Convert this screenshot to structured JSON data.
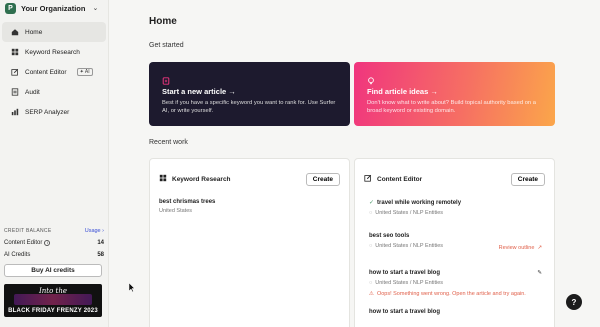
{
  "org": {
    "name": "Your Organization",
    "avatar_letter": "P"
  },
  "nav": [
    {
      "label": "Home",
      "icon": "home-icon"
    },
    {
      "label": "Keyword Research",
      "icon": "grid-icon"
    },
    {
      "label": "Content Editor",
      "icon": "edit-icon",
      "badge": "AI"
    },
    {
      "label": "Audit",
      "icon": "audit-icon"
    },
    {
      "label": "SERP Analyzer",
      "icon": "bar-chart-icon"
    }
  ],
  "credits": {
    "heading": "CREDIT BALANCE",
    "usage_link": "Usage",
    "content_editor_label": "Content Editor",
    "content_editor_value": "14",
    "ai_credits_label": "AI Credits",
    "ai_credits_value": "58",
    "buy_button": "Buy AI credits"
  },
  "promo": {
    "top": "Into the",
    "bottom": "BLACK FRIDAY FRENZY 2023"
  },
  "main": {
    "title": "Home",
    "get_started": "Get started",
    "card_article": {
      "title": "Start a new article →",
      "desc": "Best if you have a specific keyword you want to rank for. Use Surfer AI, or write yourself."
    },
    "card_ideas": {
      "title": "Find article ideas →",
      "desc": "Don't know what to write about? Build topical authority based on a broad keyword or existing domain."
    },
    "recent_work": "Recent work",
    "keyword_panel": {
      "title": "Keyword Research",
      "create": "Create",
      "items": [
        {
          "title": "best chrismas trees",
          "sub": "United States"
        }
      ]
    },
    "editor_panel": {
      "title": "Content Editor",
      "create": "Create",
      "items": [
        {
          "title": "travel while working remotely",
          "sub": "United States / NLP Entities"
        },
        {
          "title": "best seo tools",
          "sub": "United States / NLP Entities",
          "right": "Review outline"
        },
        {
          "title": "how to start a travel blog",
          "sub": "United States / NLP Entities",
          "error": "Oops! Something went wrong. Open the article and try again."
        },
        {
          "title": "how to start a travel blog"
        }
      ]
    }
  },
  "colors": {
    "accent": "#3a4fd6",
    "dark_card": "#1d1a2e",
    "error": "#e0604a"
  }
}
